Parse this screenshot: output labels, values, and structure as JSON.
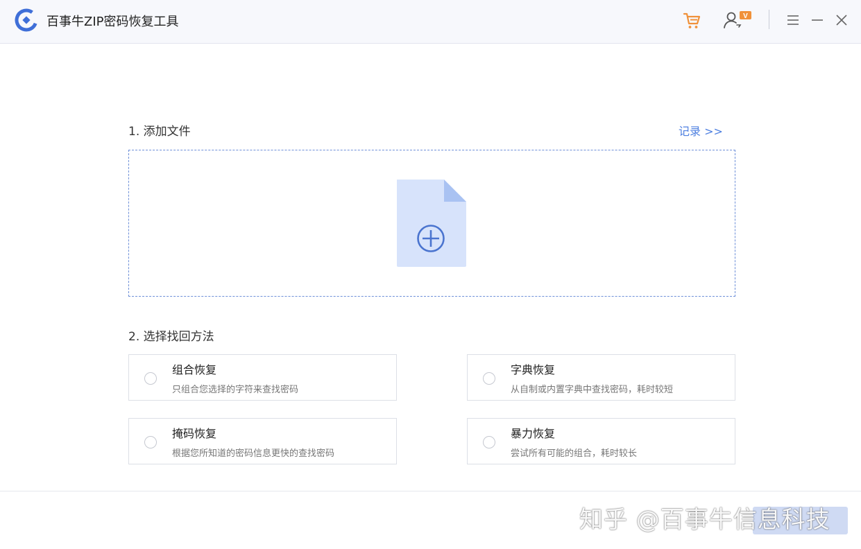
{
  "app": {
    "title": "百事牛ZIP密码恢复工具"
  },
  "toolbar": {
    "icons": {
      "cart": "cart-icon",
      "account": "account-vip-icon",
      "menu": "menu-icon",
      "minimize": "minimize-icon",
      "close": "close-icon"
    },
    "vip_badge": "V"
  },
  "step1": {
    "title": "1. 添加文件",
    "history_link": "记录 >>"
  },
  "step2": {
    "title": "2. 选择找回方法",
    "options": [
      {
        "title": "组合恢复",
        "desc": "只组合您选择的字符来查找密码"
      },
      {
        "title": "字典恢复",
        "desc": "从自制或内置字典中查找密码，耗时较短"
      },
      {
        "title": "掩码恢复",
        "desc": "根据您所知道的密码信息更快的查找密码"
      },
      {
        "title": "暴力恢复",
        "desc": "尝试所有可能的组合，耗时较长"
      }
    ]
  },
  "watermark": "知乎 @百事牛信息科技",
  "colors": {
    "accent": "#4d7fe0",
    "cart": "#f0913a",
    "file": "#d7e3fb",
    "button_disabled": "#cfdaf3"
  }
}
